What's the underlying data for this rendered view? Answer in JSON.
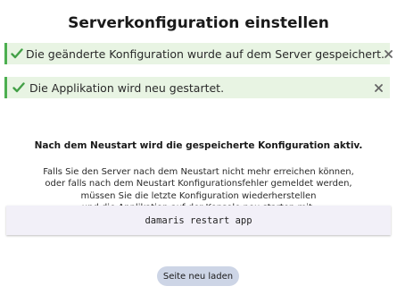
{
  "page": {
    "title": "Serverkonfiguration einstellen"
  },
  "alerts": [
    {
      "text": "Die geänderte Konfiguration wurde auf dem Server gespeichert.",
      "icon": "check-icon",
      "close_icon": "close-icon"
    },
    {
      "text": "Die Applikation wird neu gestartet.",
      "icon": "check-icon",
      "close_icon": "close-icon"
    }
  ],
  "info": {
    "heading": "Nach dem Neustart wird die gespeicherte Konfiguration aktiv.",
    "lines": [
      "Falls Sie den Server nach dem Neustart nicht mehr erreichen können,",
      "oder falls nach dem Neustart Konfigurationsfehler gemeldet werden,",
      "müssen Sie die letzte Konfiguration wiederherstellen",
      "und die Applikation auf der Konsole neu starten mit:"
    ]
  },
  "command": {
    "text": "damaris restart app"
  },
  "actions": {
    "reload_label": "Seite neu laden"
  },
  "colors": {
    "success_background": "#e8f4e3",
    "success_accent": "#4caf50",
    "button_background": "#cdd5e6",
    "command_background": "#f2f0f8"
  }
}
